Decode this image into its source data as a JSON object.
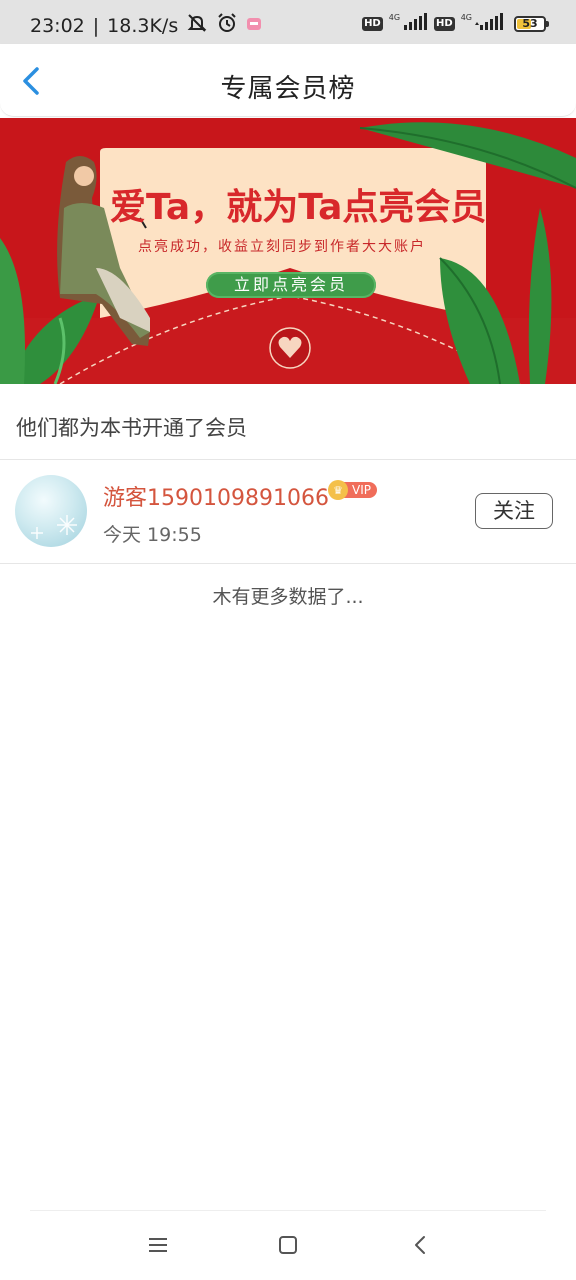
{
  "status_bar": {
    "time": "23:02",
    "speed": "18.3K/s",
    "hd1": "HD",
    "net1": "4G",
    "hd2": "HD",
    "net2": "4G",
    "battery": "53"
  },
  "header": {
    "title": "专属会员榜",
    "back_icon": "chevron-left-icon"
  },
  "banner": {
    "headline": "爱Ta，就为Ta点亮会员",
    "subtitle": "点亮成功，收益立刻同步到作者大大账户",
    "cta": "立即点亮会员"
  },
  "section": {
    "title": "他们都为本书开通了会员"
  },
  "members": [
    {
      "name": "游客1590109891066",
      "badge": "VIP",
      "time": "今天 19:55",
      "follow_label": "关注"
    }
  ],
  "footer": {
    "no_more": "木有更多数据了..."
  },
  "colors": {
    "accent_blue": "#2b8fe0",
    "username_red": "#d4553e",
    "banner_red": "#c8161b",
    "cta_green": "#3f9c4a"
  }
}
